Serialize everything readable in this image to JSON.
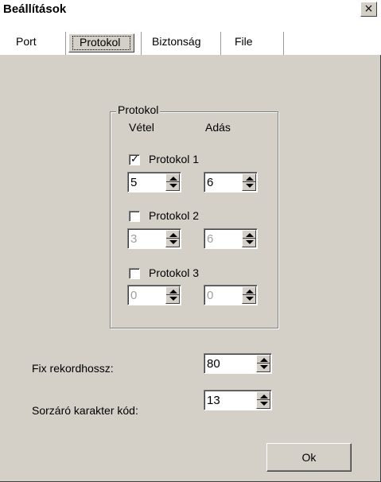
{
  "window": {
    "title": "Beállítások",
    "close_glyph": "×"
  },
  "tabs": [
    {
      "label": "Port"
    },
    {
      "label": "Protokol",
      "active": true
    },
    {
      "label": "Biztonság"
    },
    {
      "label": "File"
    }
  ],
  "group": {
    "title": "Protokol",
    "col_receive": "Vétel",
    "col_send": "Adás",
    "protocols": [
      {
        "label": "Protokol 1",
        "checked": true,
        "receive": "5",
        "send": "6"
      },
      {
        "label": "Protokol 2",
        "checked": false,
        "receive": "3",
        "send": "6"
      },
      {
        "label": "Protokol 3",
        "checked": false,
        "receive": "0",
        "send": "0"
      }
    ]
  },
  "fields": {
    "record_length_label": "Fix rekordhossz:",
    "record_length_value": "80",
    "line_end_label": "Sorzáró karakter kód:",
    "line_end_value": "13"
  },
  "buttons": {
    "ok": "Ok"
  },
  "icons": {
    "check": "checkmark-icon",
    "close": "close-icon",
    "spin": "spin-arrows-icon"
  },
  "colors": {
    "face": "#d4d0c8",
    "shadow": "#808080",
    "disabled_text": "#a0a0a0"
  }
}
